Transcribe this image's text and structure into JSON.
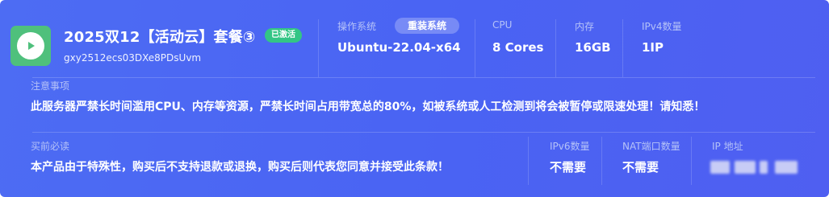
{
  "header": {
    "title": "2025双12【活动云】套餐③",
    "status_badge": "已激活",
    "instance_id": "gxy2512ecs03DXe8PDsUvm",
    "logo_icon": "play-icon"
  },
  "specs": {
    "os": {
      "label": "操作系统",
      "value": "Ubuntu-22.04-x64",
      "action": "重装系统"
    },
    "cpu": {
      "label": "CPU",
      "value": "8 Cores"
    },
    "memory": {
      "label": "内存",
      "value": "16GB"
    },
    "ipv4": {
      "label": "IPv4数量",
      "value": "1IP"
    }
  },
  "notice": {
    "label": "注意事项",
    "text": "此服务器严禁长时间滥用CPU、内存等资源，严禁长时间占用带宽总的80%，如被系统或人工检测到将会被暂停或限速处理！请知悉！"
  },
  "purchase": {
    "label": "买前必读",
    "text": "本产品由于特殊性，购买后不支持退款或退换，购买后则代表您同意并接受此条款！"
  },
  "extra": {
    "ipv6": {
      "label": "IPv6数量",
      "value": "不需要"
    },
    "nat": {
      "label": "NAT端口数量",
      "value": "不需要"
    },
    "ip": {
      "label": "IP 地址"
    }
  },
  "colors": {
    "background": "#4b66f3",
    "logo_bg": "#4fc07c",
    "badge_bg": "#33c585",
    "label_text": "#b5c2f8"
  }
}
